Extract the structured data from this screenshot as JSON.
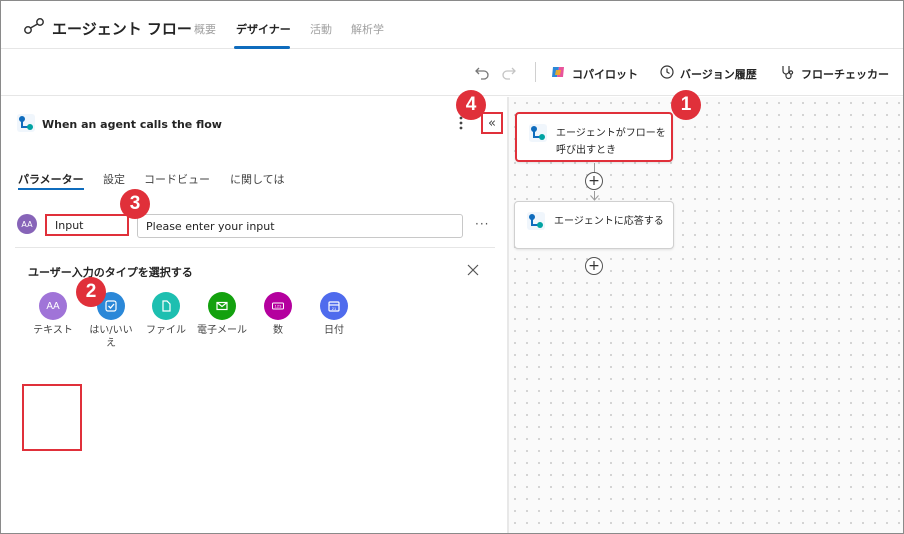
{
  "header": {
    "title": "エージェント フロー",
    "tabs": [
      {
        "label": "概要"
      },
      {
        "label": "デザイナー"
      },
      {
        "label": "活動"
      },
      {
        "label": "解析学"
      }
    ]
  },
  "toolbar": {
    "copilot_label": "コパイロット",
    "version_label": "バージョン履歴",
    "checker_label": "フローチェッカー"
  },
  "panel": {
    "trigger_title": "When an agent calls the flow",
    "collapse_glyph": "«",
    "tabs": [
      {
        "label": "パラメーター"
      },
      {
        "label": "設定"
      },
      {
        "label": "コードビュー"
      },
      {
        "label": "に関しては"
      }
    ],
    "input_row": {
      "icon_text": "AA",
      "name_value": "Input",
      "prompt_value": "Please enter your input",
      "more_label": "···"
    },
    "type_picker": {
      "title": "ユーザー入力のタイプを選択する",
      "items": [
        {
          "label": "テキスト",
          "icon": "text-icon",
          "color": "#a074d8"
        },
        {
          "label": "はい/いいえ",
          "icon": "yes-no-icon",
          "color": "#2b88d8"
        },
        {
          "label": "ファイル",
          "icon": "file-icon",
          "color": "#1dbfb0"
        },
        {
          "label": "電子メール",
          "icon": "email-icon",
          "color": "#13a10e"
        },
        {
          "label": "数",
          "icon": "number-icon",
          "color": "#b4009e"
        },
        {
          "label": "日付",
          "icon": "date-icon",
          "color": "#4f6bed"
        }
      ]
    }
  },
  "canvas": {
    "nodes": [
      {
        "label": "エージェントがフローを呼び出すとき"
      },
      {
        "label": "エージェントに応答する"
      }
    ]
  },
  "callouts": [
    "1",
    "2",
    "3",
    "4"
  ],
  "colors": {
    "accent": "#0f6cbd",
    "highlight": "#e0303a"
  }
}
